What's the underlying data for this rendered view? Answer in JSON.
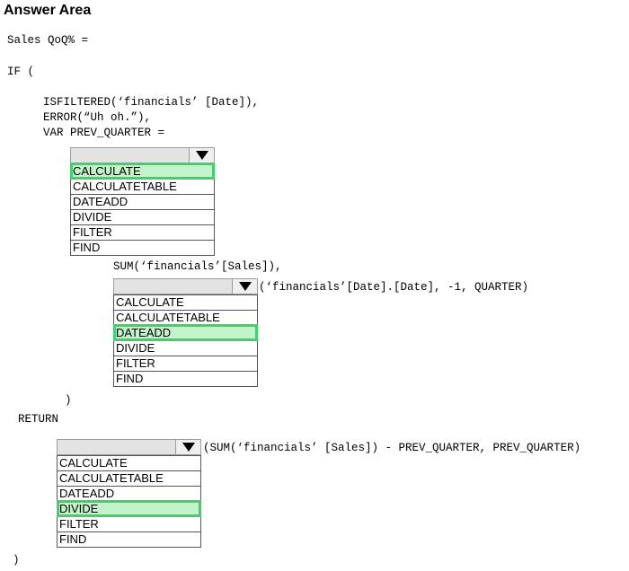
{
  "title": "Answer Area",
  "code": {
    "line1": "Sales QoQ% =",
    "line2": "IF (",
    "line3": "ISFILTERED(‘financials’ [Date]),",
    "line4": "ERROR(“Uh oh.”),",
    "line5": "VAR PREV_QUARTER =",
    "line6": "SUM(‘financials’[Sales]),",
    "line7": "(‘financials’[Date].[Date], -1, QUARTER)",
    "line8": ")",
    "line9": "RETURN",
    "line10": "(SUM(‘financials’ [Sales]) - PREV_QUARTER, PREV_QUARTER)",
    "line11": ")"
  },
  "dropdown1": {
    "options": [
      "CALCULATE",
      "CALCULATETABLE",
      "DATEADD",
      "DIVIDE",
      "FILTER",
      "FIND"
    ],
    "selected": "CALCULATE"
  },
  "dropdown2": {
    "options": [
      "CALCULATE",
      "CALCULATETABLE",
      "DATEADD",
      "DIVIDE",
      "FILTER",
      "FIND"
    ],
    "selected": "DATEADD"
  },
  "dropdown3": {
    "options": [
      "CALCULATE",
      "CALCULATETABLE",
      "DATEADD",
      "DIVIDE",
      "FILTER",
      "FIND"
    ],
    "selected": "DIVIDE"
  },
  "icons": {
    "dropdown_arrow": "triangle-down-icon"
  },
  "colors": {
    "highlight_border": "#3ed36a",
    "highlight_fill": "#c3f4c9"
  }
}
